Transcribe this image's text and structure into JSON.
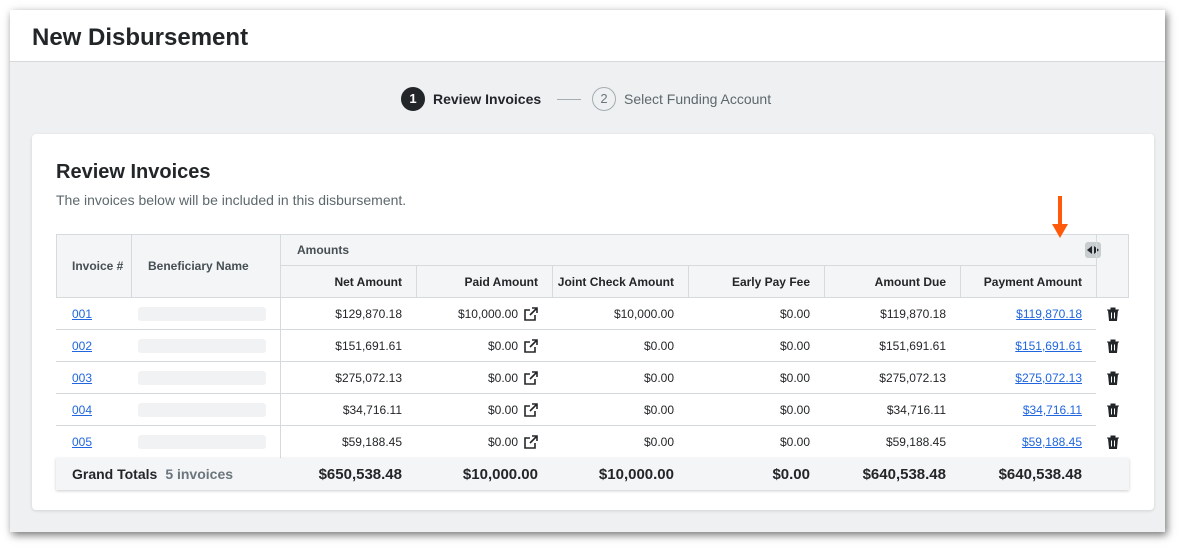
{
  "page": {
    "title": "New Disbursement"
  },
  "steps": [
    {
      "number": "1",
      "label": "Review Invoices",
      "active": true
    },
    {
      "number": "2",
      "label": "Select Funding Account",
      "active": false
    }
  ],
  "card": {
    "title": "Review Invoices",
    "subtitle": "The invoices below will be included in this disbursement."
  },
  "table": {
    "col_invoice": "Invoice #",
    "col_beneficiary": "Beneficiary Name",
    "group_amounts": "Amounts",
    "columns": [
      "Net Amount",
      "Paid Amount",
      "Joint Check Amount",
      "Early Pay Fee",
      "Amount Due",
      "Payment Amount"
    ],
    "rows": [
      {
        "invoice": "001",
        "net": "$129,870.18",
        "paid": "$10,000.00",
        "joint": "$10,000.00",
        "early": "$0.00",
        "due": "$119,870.18",
        "payment": "$119,870.18"
      },
      {
        "invoice": "002",
        "net": "$151,691.61",
        "paid": "$0.00",
        "joint": "$0.00",
        "early": "$0.00",
        "due": "$151,691.61",
        "payment": "$151,691.61"
      },
      {
        "invoice": "003",
        "net": "$275,072.13",
        "paid": "$0.00",
        "joint": "$0.00",
        "early": "$0.00",
        "due": "$275,072.13",
        "payment": "$275,072.13"
      },
      {
        "invoice": "004",
        "net": "$34,716.11",
        "paid": "$0.00",
        "joint": "$0.00",
        "early": "$0.00",
        "due": "$34,716.11",
        "payment": "$34,716.11"
      },
      {
        "invoice": "005",
        "net": "$59,188.45",
        "paid": "$0.00",
        "joint": "$0.00",
        "early": "$0.00",
        "due": "$59,188.45",
        "payment": "$59,188.45"
      }
    ],
    "totals": {
      "label": "Grand Totals",
      "count": "5 invoices",
      "net": "$650,538.48",
      "paid": "$10,000.00",
      "joint": "$10,000.00",
      "early": "$0.00",
      "due": "$640,538.48",
      "payment": "$640,538.48"
    }
  },
  "colors": {
    "link": "#2066df",
    "annotation_arrow": "#ff5a0a",
    "active_step": "#232628"
  },
  "icons": {
    "external_link": "external-link-icon",
    "delete": "trash-icon",
    "resize": "column-resize-icon"
  }
}
